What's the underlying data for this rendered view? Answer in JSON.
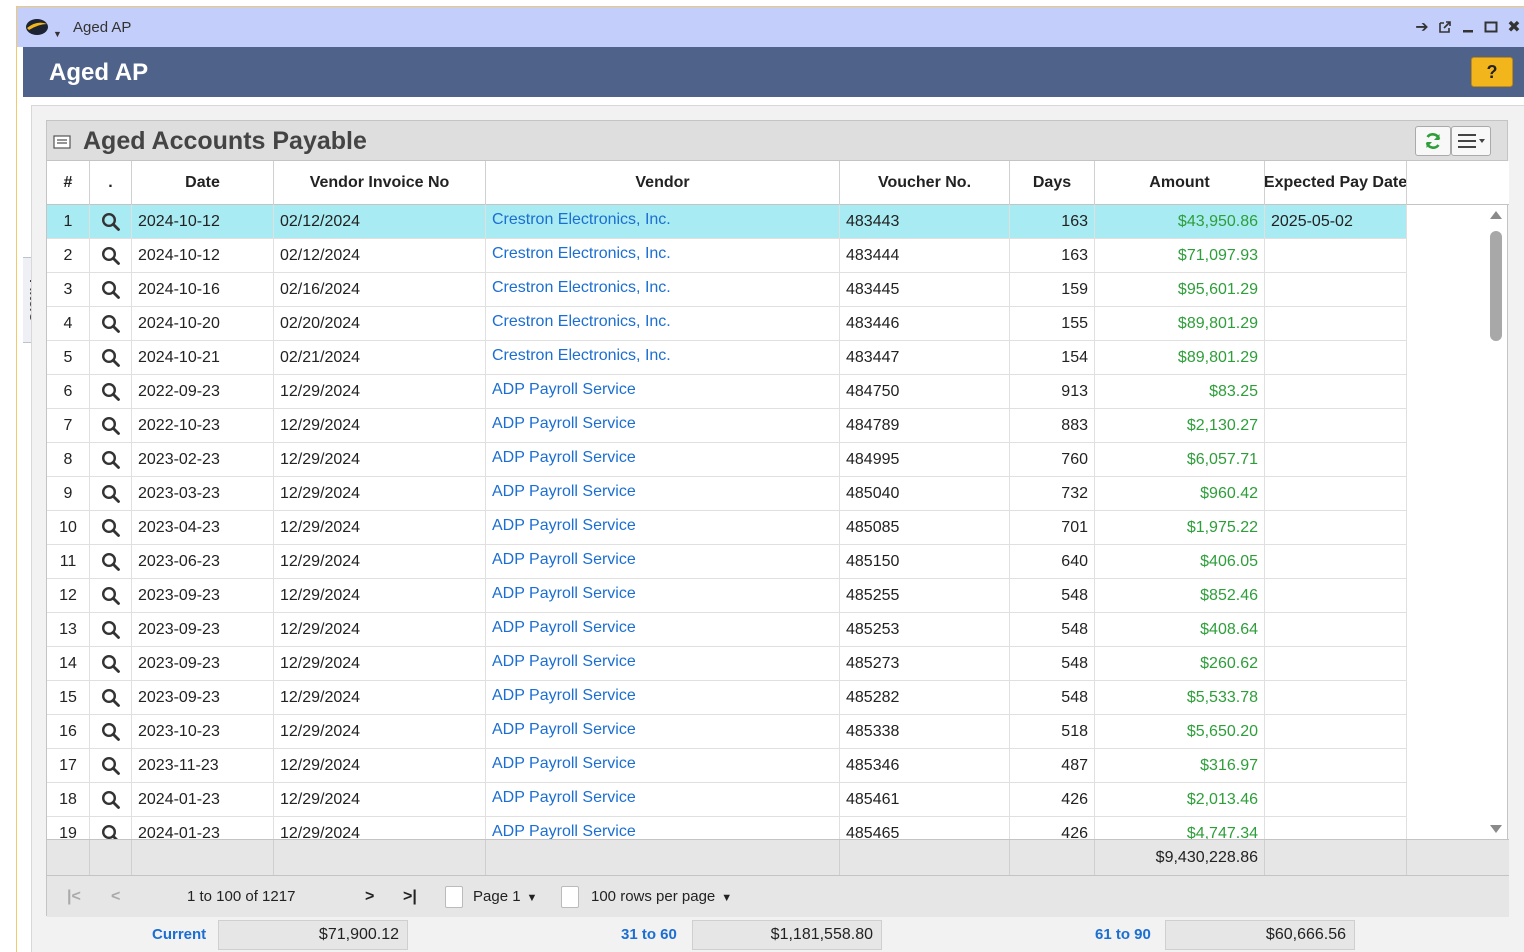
{
  "window": {
    "title": "Aged AP"
  },
  "header": {
    "title": "Aged AP",
    "help_label": "?"
  },
  "filters": {
    "label": "Filters"
  },
  "grid": {
    "title": "Aged Accounts Payable",
    "columns": [
      "#",
      ".",
      "Date",
      "Vendor Invoice No",
      "Vendor",
      "Voucher No.",
      "Days",
      "Amount",
      "Expected Pay Date"
    ],
    "rows": [
      {
        "n": "1",
        "date": "2024-10-12",
        "invoice": "02/12/2024",
        "vendor": "Crestron Electronics, Inc.",
        "voucher": "483443",
        "days": "163",
        "amount": "$43,950.86",
        "pay_date": "2025-05-02"
      },
      {
        "n": "2",
        "date": "2024-10-12",
        "invoice": "02/12/2024",
        "vendor": "Crestron Electronics, Inc.",
        "voucher": "483444",
        "days": "163",
        "amount": "$71,097.93",
        "pay_date": ""
      },
      {
        "n": "3",
        "date": "2024-10-16",
        "invoice": "02/16/2024",
        "vendor": "Crestron Electronics, Inc.",
        "voucher": "483445",
        "days": "159",
        "amount": "$95,601.29",
        "pay_date": ""
      },
      {
        "n": "4",
        "date": "2024-10-20",
        "invoice": "02/20/2024",
        "vendor": "Crestron Electronics, Inc.",
        "voucher": "483446",
        "days": "155",
        "amount": "$89,801.29",
        "pay_date": ""
      },
      {
        "n": "5",
        "date": "2024-10-21",
        "invoice": "02/21/2024",
        "vendor": "Crestron Electronics, Inc.",
        "voucher": "483447",
        "days": "154",
        "amount": "$89,801.29",
        "pay_date": ""
      },
      {
        "n": "6",
        "date": "2022-09-23",
        "invoice": "12/29/2024",
        "vendor": "ADP Payroll Service",
        "voucher": "484750",
        "days": "913",
        "amount": "$83.25",
        "pay_date": ""
      },
      {
        "n": "7",
        "date": "2022-10-23",
        "invoice": "12/29/2024",
        "vendor": "ADP Payroll Service",
        "voucher": "484789",
        "days": "883",
        "amount": "$2,130.27",
        "pay_date": ""
      },
      {
        "n": "8",
        "date": "2023-02-23",
        "invoice": "12/29/2024",
        "vendor": "ADP Payroll Service",
        "voucher": "484995",
        "days": "760",
        "amount": "$6,057.71",
        "pay_date": ""
      },
      {
        "n": "9",
        "date": "2023-03-23",
        "invoice": "12/29/2024",
        "vendor": "ADP Payroll Service",
        "voucher": "485040",
        "days": "732",
        "amount": "$960.42",
        "pay_date": ""
      },
      {
        "n": "10",
        "date": "2023-04-23",
        "invoice": "12/29/2024",
        "vendor": "ADP Payroll Service",
        "voucher": "485085",
        "days": "701",
        "amount": "$1,975.22",
        "pay_date": ""
      },
      {
        "n": "11",
        "date": "2023-06-23",
        "invoice": "12/29/2024",
        "vendor": "ADP Payroll Service",
        "voucher": "485150",
        "days": "640",
        "amount": "$406.05",
        "pay_date": ""
      },
      {
        "n": "12",
        "date": "2023-09-23",
        "invoice": "12/29/2024",
        "vendor": "ADP Payroll Service",
        "voucher": "485255",
        "days": "548",
        "amount": "$852.46",
        "pay_date": ""
      },
      {
        "n": "13",
        "date": "2023-09-23",
        "invoice": "12/29/2024",
        "vendor": "ADP Payroll Service",
        "voucher": "485253",
        "days": "548",
        "amount": "$408.64",
        "pay_date": ""
      },
      {
        "n": "14",
        "date": "2023-09-23",
        "invoice": "12/29/2024",
        "vendor": "ADP Payroll Service",
        "voucher": "485273",
        "days": "548",
        "amount": "$260.62",
        "pay_date": ""
      },
      {
        "n": "15",
        "date": "2023-09-23",
        "invoice": "12/29/2024",
        "vendor": "ADP Payroll Service",
        "voucher": "485282",
        "days": "548",
        "amount": "$5,533.78",
        "pay_date": ""
      },
      {
        "n": "16",
        "date": "2023-10-23",
        "invoice": "12/29/2024",
        "vendor": "ADP Payroll Service",
        "voucher": "485338",
        "days": "518",
        "amount": "$5,650.20",
        "pay_date": ""
      },
      {
        "n": "17",
        "date": "2023-11-23",
        "invoice": "12/29/2024",
        "vendor": "ADP Payroll Service",
        "voucher": "485346",
        "days": "487",
        "amount": "$316.97",
        "pay_date": ""
      },
      {
        "n": "18",
        "date": "2024-01-23",
        "invoice": "12/29/2024",
        "vendor": "ADP Payroll Service",
        "voucher": "485461",
        "days": "426",
        "amount": "$2,013.46",
        "pay_date": ""
      },
      {
        "n": "19",
        "date": "2024-01-23",
        "invoice": "12/29/2024",
        "vendor": "ADP Payroll Service",
        "voucher": "485465",
        "days": "426",
        "amount": "$4,747.34",
        "pay_date": ""
      }
    ],
    "total_amount": "$9,430,228.86"
  },
  "pager": {
    "range_text": "1 to 100 of 1217",
    "page_label": "Page 1",
    "rows_per_page": "100 rows per page"
  },
  "buckets": [
    {
      "label": "Current",
      "value": "$71,900.12"
    },
    {
      "label": "31 to 60",
      "value": "$1,181,558.80"
    },
    {
      "label": "61 to 90",
      "value": "$60,666.56"
    }
  ],
  "colors": {
    "window_bar": "#c3cffa",
    "header": "#4f6289",
    "help_button": "#f3b51c",
    "selected_row": "#a8ebf2",
    "link": "#1b6ed2",
    "amount": "#2e9e3a"
  },
  "icons": [
    "app-logo-icon",
    "arrow-right-icon",
    "popout-icon",
    "minimize-icon",
    "maximize-icon",
    "close-icon",
    "collapse-panel-icon",
    "refresh-icon",
    "column-menu-icon",
    "search-icon",
    "first-page-icon",
    "prev-page-icon",
    "next-page-icon",
    "last-page-icon",
    "page-icon",
    "chevron-down-icon"
  ]
}
